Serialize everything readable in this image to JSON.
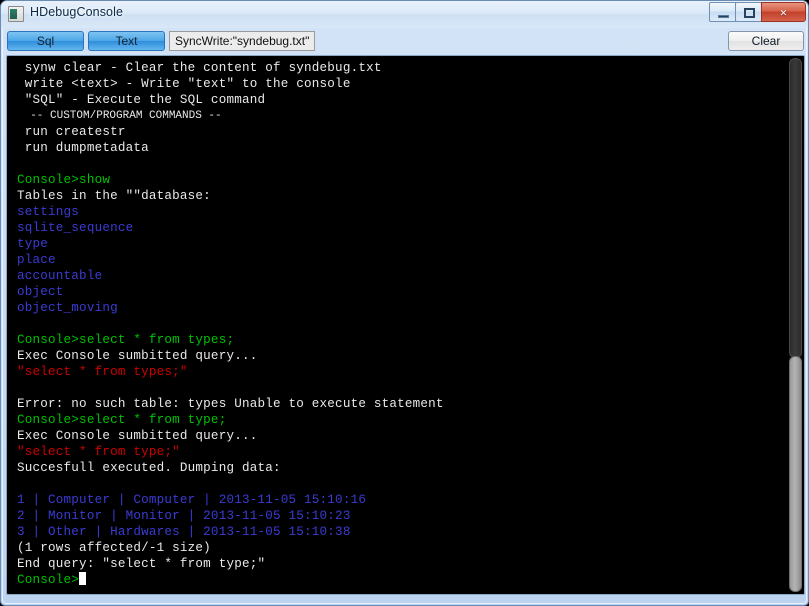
{
  "window": {
    "title": "HDebugConsole",
    "icon": "app-icon",
    "controls": {
      "minimize": "minimize-icon",
      "maximize": "maximize-icon",
      "close": "×"
    }
  },
  "toolbar": {
    "sql_label": "Sql",
    "text_label": "Text",
    "syncwrite_label": "SyncWrite:\"syndebug.txt\"",
    "clear_label": "Clear"
  },
  "console": {
    "prompt": "Console>",
    "cursor_visible": true,
    "lines": [
      {
        "text": " synw clear - Clear the content of syndebug.txt",
        "color": "white"
      },
      {
        "text": " write <text> - Write \"text\" to the console",
        "color": "white"
      },
      {
        "text": " \"SQL\" - Execute the SQL command",
        "color": "white"
      },
      {
        "text": "  -- CUSTOM/PROGRAM COMMANDS --",
        "color": "white",
        "small": true
      },
      {
        "text": " run createstr",
        "color": "white"
      },
      {
        "text": " run dumpmetadata",
        "color": "white"
      },
      {
        "text": "",
        "color": "white"
      },
      {
        "text": "Console>show",
        "color": "green"
      },
      {
        "text": "Tables in the \"\"database:",
        "color": "white"
      },
      {
        "text": "settings",
        "color": "blue"
      },
      {
        "text": "sqlite_sequence",
        "color": "blue"
      },
      {
        "text": "type",
        "color": "blue"
      },
      {
        "text": "place",
        "color": "blue"
      },
      {
        "text": "accountable",
        "color": "blue"
      },
      {
        "text": "object",
        "color": "blue"
      },
      {
        "text": "object_moving",
        "color": "blue"
      },
      {
        "text": "",
        "color": "white"
      },
      {
        "text": "Console>select * from types;",
        "color": "green"
      },
      {
        "text": "Exec Console sumbitted query...",
        "color": "white"
      },
      {
        "text": "\"select * from types;\"",
        "color": "red"
      },
      {
        "text": "",
        "color": "white"
      },
      {
        "text": "Error: no such table: types Unable to execute statement",
        "color": "white"
      },
      {
        "text": "Console>select * from type;",
        "color": "green"
      },
      {
        "text": "Exec Console sumbitted query...",
        "color": "white"
      },
      {
        "text": "\"select * from type;\"",
        "color": "red"
      },
      {
        "text": "Succesfull executed. Dumping data:",
        "color": "white"
      },
      {
        "text": "",
        "color": "white"
      },
      {
        "text": "1 | Computer | Computer | 2013-11-05 15:10:16",
        "color": "blue"
      },
      {
        "text": "2 | Monitor | Monitor | 2013-11-05 15:10:23",
        "color": "blue"
      },
      {
        "text": "3 | Other | Hardwares | 2013-11-05 15:10:38",
        "color": "blue"
      },
      {
        "text": "(1 rows affected/-1 size)",
        "color": "white"
      },
      {
        "text": "End query: \"select * from type;\"",
        "color": "white"
      },
      {
        "text": "Console>",
        "color": "green",
        "cursor": true
      }
    ]
  },
  "colors": {
    "background": "#000000",
    "text_white": "#e9e9e9",
    "text_green": "#00c000",
    "text_blue": "#3b3bd4",
    "text_red": "#cc0000",
    "accent_button": "#2e8ddb",
    "close_button": "#c2402c"
  },
  "scrollbar": {
    "orientation": "vertical",
    "thumb_position": "bottom"
  }
}
